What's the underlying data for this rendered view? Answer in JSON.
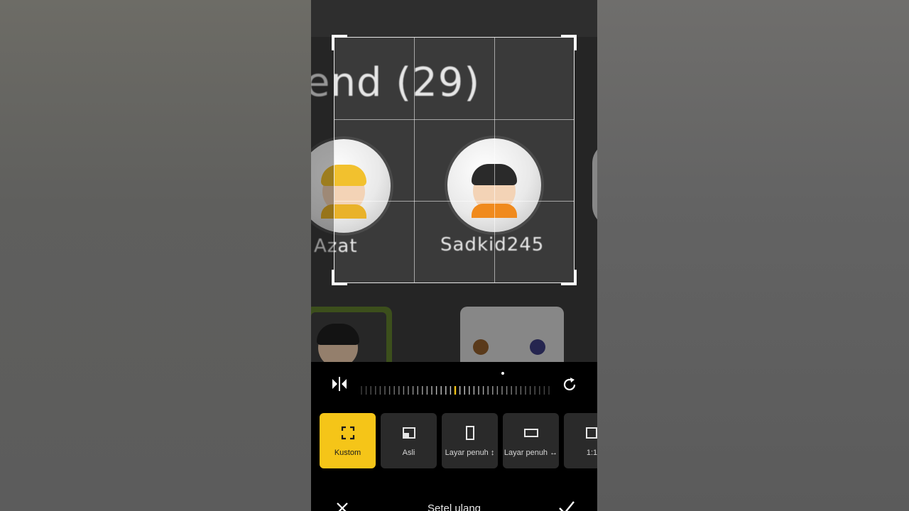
{
  "preview": {
    "heading_text": "end (29)",
    "usernames": [
      "Azat",
      "Sadkid245"
    ]
  },
  "toolbar": {
    "flip_icon": "flip-horizontal-icon",
    "rotate_icon": "rotate-icon",
    "angle_ruler": {
      "ticks": 41,
      "selected_tick": 20
    }
  },
  "aspect_ratios": [
    {
      "label": "Kustom",
      "icon": "freeform-crop-icon",
      "selected": true
    },
    {
      "label": "Asli",
      "icon": "original-ratio-icon",
      "selected": false
    },
    {
      "label": "Layar penuh ↕",
      "icon": "portrait-fullscreen-icon",
      "selected": false
    },
    {
      "label": "Layar penuh ↔",
      "icon": "landscape-fullscreen-icon",
      "selected": false
    },
    {
      "label": "1:1",
      "icon": "square-ratio-icon",
      "selected": false
    }
  ],
  "footer": {
    "reset_label": "Setel ulang",
    "cancel_icon": "close-icon",
    "confirm_icon": "checkmark-icon"
  },
  "colors": {
    "accent": "#f5c518",
    "panel_bg": "#000000",
    "chip_bg": "#2a2a2a"
  }
}
